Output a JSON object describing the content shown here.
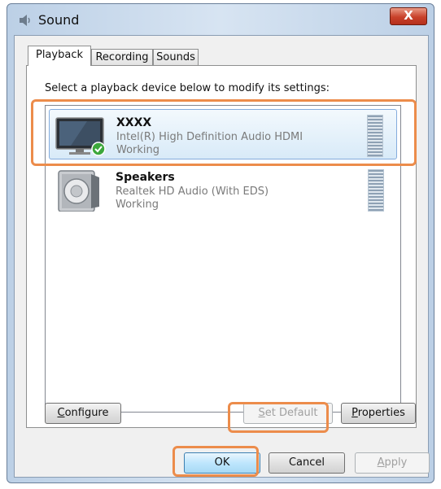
{
  "window": {
    "title": "Sound",
    "close_label": "X"
  },
  "tabs": [
    {
      "label": "Playback",
      "active": true
    },
    {
      "label": "Recording",
      "active": false
    },
    {
      "label": "Sounds",
      "active": false
    }
  ],
  "instruction": "Select a playback device below to modify its settings:",
  "devices": [
    {
      "name": "XXXX",
      "driver": "Intel(R) High Definition Audio HDMI",
      "status": "Working",
      "icon": "monitor-icon",
      "default": true,
      "selected": true
    },
    {
      "name": "Speakers",
      "driver": "Realtek HD Audio (With EDS)",
      "status": "Working",
      "icon": "speaker-icon",
      "default": false,
      "selected": false
    }
  ],
  "buttons": {
    "configure": {
      "key": "C",
      "rest": "onfigure"
    },
    "set_default": {
      "key": "S",
      "rest": "et Default"
    },
    "properties": {
      "key": "P",
      "rest": "roperties"
    },
    "ok": "OK",
    "cancel": "Cancel",
    "apply": {
      "key": "A",
      "rest": "pply"
    }
  },
  "colors": {
    "highlight": "#ec8c4b",
    "selection": "#d8eaf8"
  }
}
